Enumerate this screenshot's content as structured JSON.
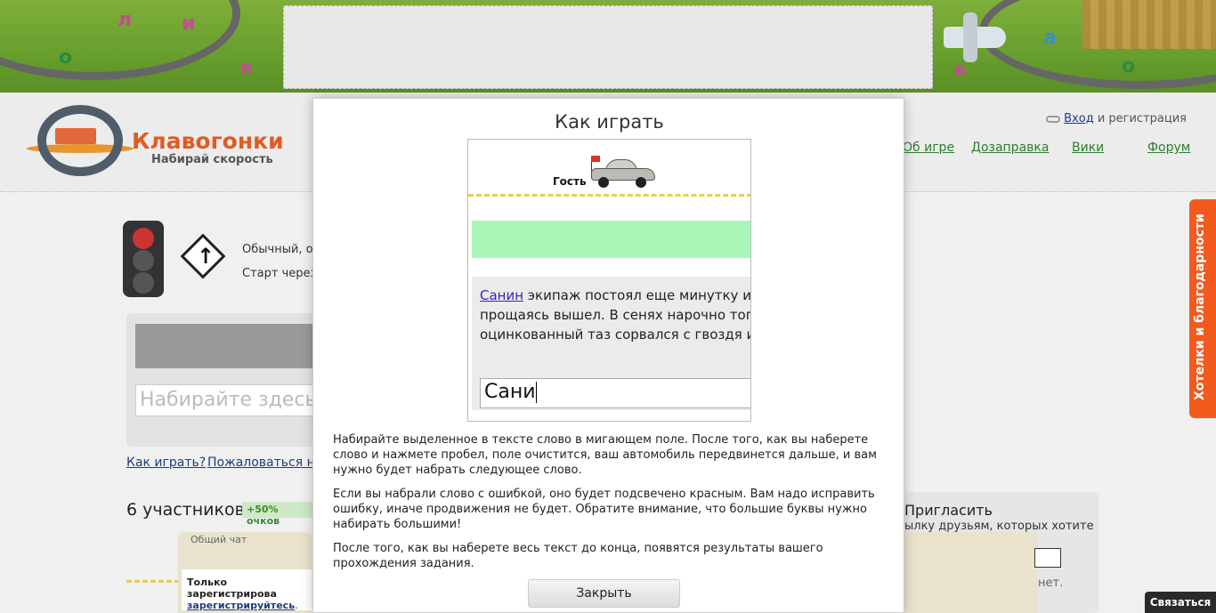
{
  "site": {
    "logo_title": "Клавогонки",
    "logo_subtitle": "Набирай скорость"
  },
  "banner": {
    "letters": [
      "о",
      "к",
      "и",
      "а",
      "к",
      "о",
      "л"
    ]
  },
  "header": {
    "login_link": "Вход",
    "login_rest": " и регистрация",
    "nav": [
      "Об игре",
      "Дозаправка",
      "Вики",
      "Форум"
    ]
  },
  "game": {
    "race_type": "Обычный, от",
    "start_text": "Старт через",
    "input_placeholder": "Набирайте здесь",
    "how_to_play": "Как играть?",
    "complain": "Пожаловаться на т",
    "participants": "6 участников",
    "bonus": "+50% очков"
  },
  "chat": {
    "tab": "Общий чат",
    "registered_only": "Только зарегистрирова",
    "register_link": "зарегистрируйтесь",
    "register_suffix": "."
  },
  "invite": {
    "title": "Пригласить",
    "text": "ылку друзьям, которых хотите",
    "net": "нет."
  },
  "modal": {
    "title": "Как играть",
    "demo": {
      "player_name": "Гость",
      "highlighted_word": "Санин",
      "line1_rest": " экипаж постоял еще минутку и,",
      "line2": "прощаясь вышел. В сенях нарочно топ",
      "line3": "оцинкованный таз сорвался с гвоздя и",
      "input_value": "Сани"
    },
    "paragraphs": [
      "Набирайте выделенное в тексте слово в мигающем поле. После того, как вы наберете слово и нажмете пробел, поле очистится, ваш автомобиль передвинется дальше, и вам нужно будет набрать следующее слово.",
      "Если вы набрали слово с ошибкой, оно будет подсвечено красным. Вам надо исправить ошибку, иначе продвижения не будет. Обратите внимание, что большие буквы нужно набирать большими!",
      "После того, как вы наберете весь текст до конца, появятся результаты вашего прохождения задания."
    ],
    "close_button": "Закрыть"
  },
  "side": {
    "feedback": "Хотелки и благодарности",
    "contact": "Связаться"
  }
}
